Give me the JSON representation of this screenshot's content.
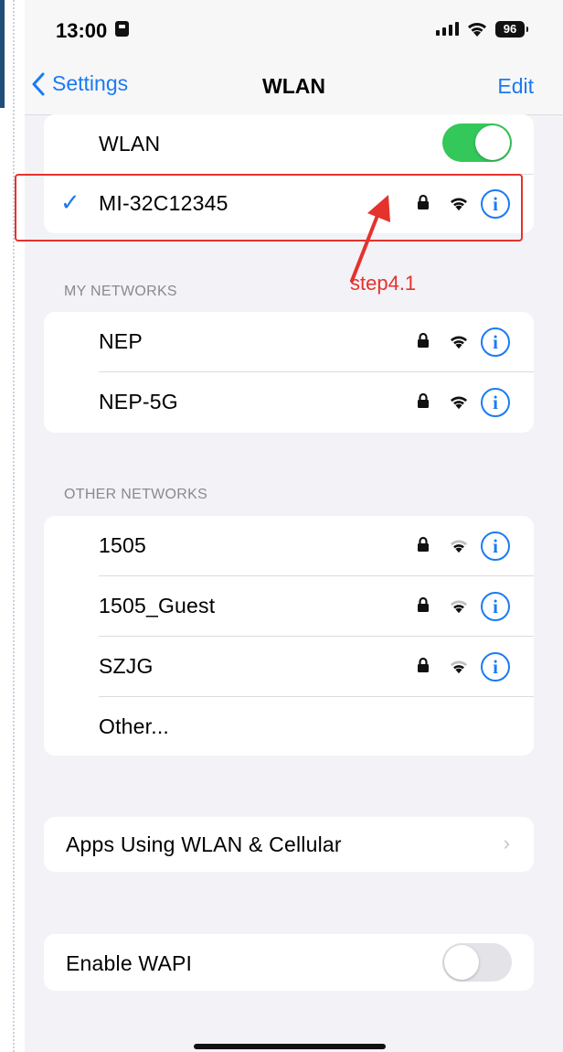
{
  "status_bar": {
    "time": "13:00",
    "battery": "96"
  },
  "nav": {
    "back_label": "Settings",
    "title": "WLAN",
    "edit_label": "Edit"
  },
  "wlan_card": {
    "toggle_label": "WLAN",
    "toggle_on": true,
    "connected_network": "MI-32C12345"
  },
  "annotation": {
    "step_label": "step4.1",
    "color": "#e5322d"
  },
  "my_networks": {
    "header": "MY NETWORKS",
    "items": [
      {
        "name": "NEP",
        "secured": true,
        "signal": "strong"
      },
      {
        "name": "NEP-5G",
        "secured": true,
        "signal": "strong"
      }
    ]
  },
  "other_networks": {
    "header": "OTHER NETWORKS",
    "items": [
      {
        "name": "1505",
        "secured": true,
        "signal": "weak"
      },
      {
        "name": "1505_Guest",
        "secured": true,
        "signal": "weak"
      },
      {
        "name": "SZJG",
        "secured": true,
        "signal": "weak"
      }
    ],
    "other_label": "Other..."
  },
  "apps_row": {
    "label": "Apps Using WLAN & Cellular"
  },
  "wapi_row": {
    "label": "Enable WAPI",
    "toggle_on": false
  },
  "colors": {
    "accent": "#1a7bf2",
    "toggle_on": "#34c759",
    "background": "#f2f2f7"
  }
}
